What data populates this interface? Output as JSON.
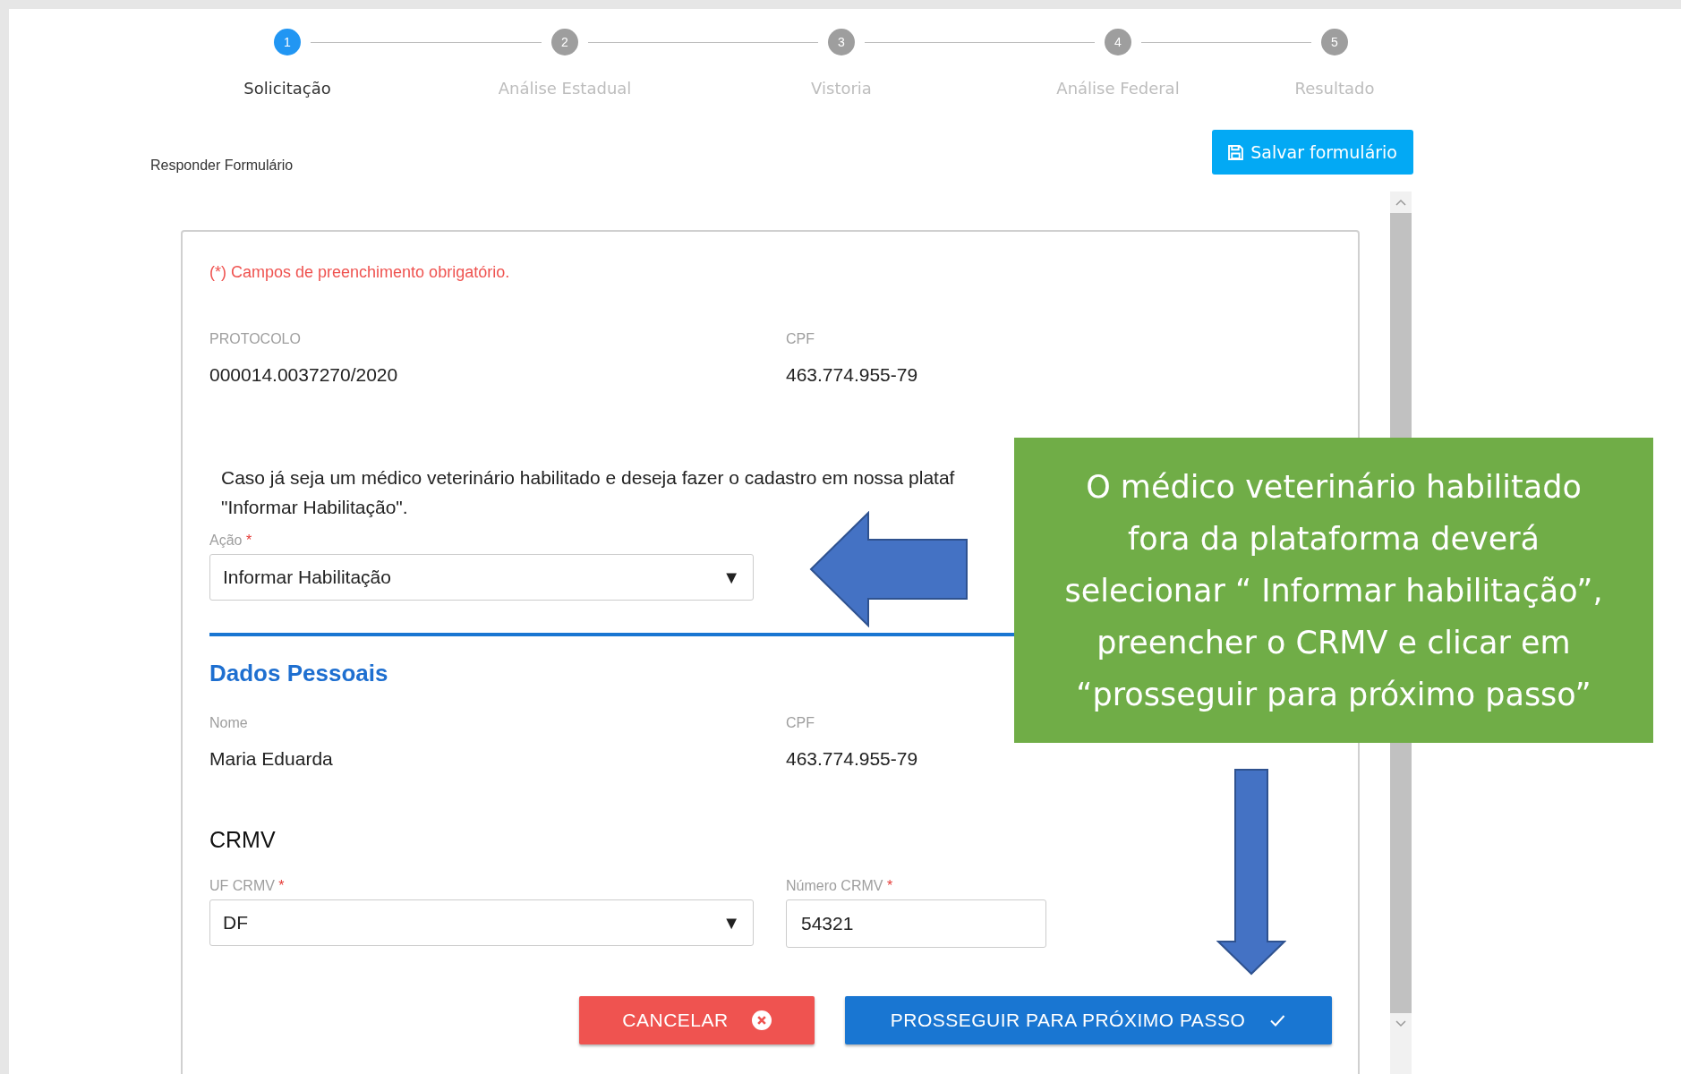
{
  "stepper": [
    {
      "number": "1",
      "label": "Solicitação",
      "selected": true
    },
    {
      "number": "2",
      "label": "Análise Estadual",
      "selected": false
    },
    {
      "number": "3",
      "label": "Vistoria",
      "selected": false
    },
    {
      "number": "4",
      "label": "Análise Federal",
      "selected": false
    },
    {
      "number": "5",
      "label": "Resultado",
      "selected": false
    }
  ],
  "page_title": "Responder Formulário",
  "save_button": {
    "label": "Salvar formulário"
  },
  "form": {
    "required_note": "(*) Campos de preenchimento obrigatório.",
    "info_fields": [
      {
        "label": "PROTOCOLO",
        "value": "000014.0037270/2020"
      },
      {
        "label": "CPF",
        "value": "463.774.955-79"
      }
    ],
    "instruction_lines": [
      "Caso já seja um médico veterinário habilitado e deseja fazer o cadastro em nossa plataf",
      "\"Informar Habilitação\"."
    ],
    "action_select": {
      "label": "Ação",
      "required_mark": "*",
      "value": "Informar Habilitação",
      "arrow": "▼"
    },
    "section_title": "Dados Pessoais",
    "personal_fields": [
      {
        "label": "Nome",
        "value": "Maria Eduarda"
      },
      {
        "label": "CPF",
        "value": "463.774.955-79"
      }
    ],
    "crmv_title": "CRMV",
    "crmv_fields": [
      {
        "kind": "select",
        "label": "UF CRMV",
        "required_mark": "*",
        "value": "DF",
        "arrow": "▼"
      },
      {
        "kind": "input",
        "label": "Número CRMV",
        "required_mark": "*",
        "value": "54321"
      }
    ],
    "buttons": [
      {
        "kind": "cancel",
        "label": "CANCELAR"
      },
      {
        "kind": "proceed",
        "label": "PROSSEGUIR PARA PRÓXIMO PASSO"
      }
    ]
  },
  "callout": {
    "lines": [
      "O médico veterinário habilitado",
      "fora da plataforma deverá",
      "selecionar “ Informar habilitação”,",
      "preencher o CRMV e clicar em",
      "“prosseguir para próximo passo”"
    ]
  }
}
